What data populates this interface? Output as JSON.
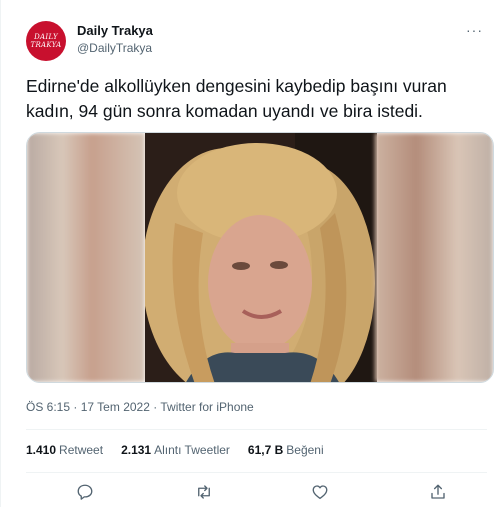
{
  "author": {
    "display_name": "Daily Trakya",
    "handle": "@DailyTrakya",
    "avatar_lines": [
      "DAILY",
      "TRAKYA"
    ]
  },
  "more_icon": "ellipsis-icon",
  "tweet": {
    "text": "Edirne'de alkollüyken dengesini kaybedip başını vuran kadın, 94 gün sonra komadan uyandı ve bira istedi.",
    "time": "ÖS 6:15",
    "date": "17 Tem 2022",
    "source": "Twitter for iPhone",
    "separator": "·"
  },
  "stats": {
    "retweets_count": "1.410",
    "retweets_label": "Retweet",
    "quotes_count": "2.131",
    "quotes_label": "Alıntı Tweetler",
    "likes_count": "61,7 B",
    "likes_label": "Beğeni"
  },
  "actions": [
    "reply-icon",
    "retweet-icon",
    "like-icon",
    "share-icon"
  ],
  "colors": {
    "avatar_bg": "#c8102e",
    "text": "#0f1419",
    "secondary": "#536471",
    "divider": "#eff3f4"
  }
}
